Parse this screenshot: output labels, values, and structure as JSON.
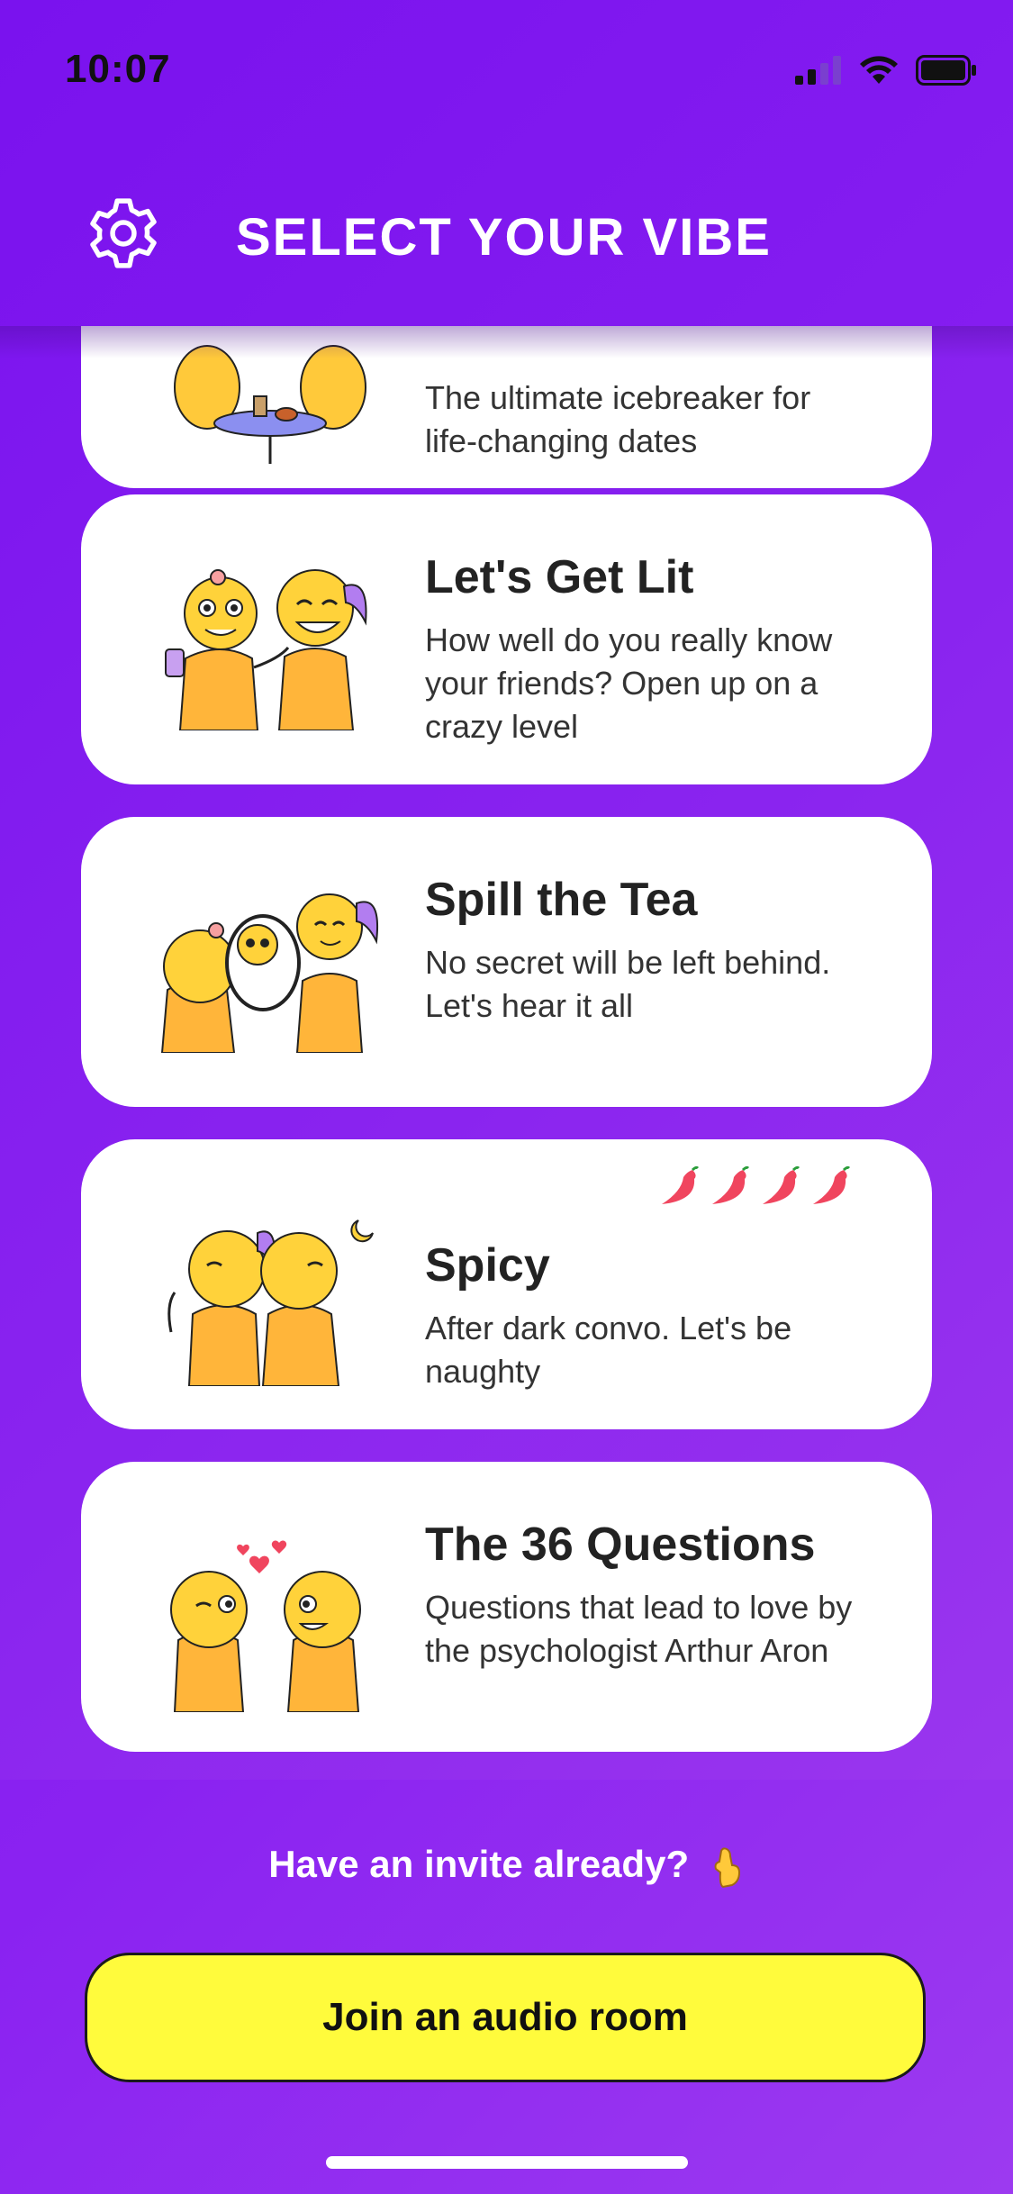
{
  "status_bar": {
    "time": "10:07",
    "icons": [
      "cellular-signal-icon",
      "wifi-icon",
      "battery-icon"
    ]
  },
  "header": {
    "title": "SELECT YOUR VIBE",
    "settings_icon": "gear-icon"
  },
  "vibes": [
    {
      "name": "",
      "description_visible": "The ultimate icebreaker for life-changing dates",
      "art": "couple-at-cafe-table"
    },
    {
      "name": "Let's Get Lit",
      "description": "How well do you really know your friends? Open up on a crazy level",
      "art": "friends-laughing"
    },
    {
      "name": "Spill the Tea",
      "description": "No secret will be left behind. Let's hear it all",
      "art": "gossip-mirror"
    },
    {
      "name": "Spicy",
      "description": "After dark convo. Let's be naughty",
      "art": "couple-back-to-back",
      "spice_level": 4
    },
    {
      "name": "The 36 Questions",
      "description": "Questions that lead to love by the psychologist Arthur Aron",
      "art": "couple-with-hearts"
    }
  ],
  "footer": {
    "invite_text": "Have an invite already?",
    "invite_emoji": "pointing-down-hand-icon",
    "join_button_label": "Join an audio room"
  },
  "colors": {
    "background": "#8420f0",
    "card": "#ffffff",
    "button": "#fffb3c",
    "pepper": "#f0455e",
    "character": "#ffc93a"
  }
}
